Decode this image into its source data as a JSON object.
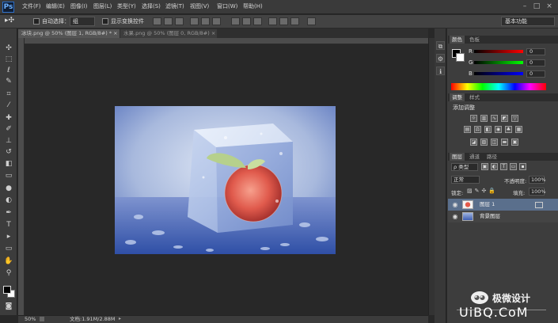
{
  "app": {
    "logo": "Ps"
  },
  "menubar": {
    "items": [
      "文件(F)",
      "编辑(E)",
      "图像(I)",
      "图层(L)",
      "类型(Y)",
      "选择(S)",
      "滤镜(T)",
      "视图(V)",
      "窗口(W)",
      "帮助(H)"
    ],
    "minimize": "–",
    "maximize": "□",
    "close": "×"
  },
  "options": {
    "tool_icon": "move-tool-icon",
    "auto_select_label": "自动选择：",
    "auto_select_value": "组",
    "show_transform_label": "显示变换控件",
    "workspace": "基本功能"
  },
  "tabs": [
    {
      "label": "冰块.png @ 50% (图层 1, RGB/8#) *",
      "close": "×"
    },
    {
      "label": "水果.png @ 50% (图层 0, RGB/8#)",
      "close": "×"
    }
  ],
  "status": {
    "zoom": "50%",
    "doc": "文档:1.91M/2.88M"
  },
  "color_panel": {
    "tabs": [
      "颜色",
      "色板"
    ],
    "channels": [
      {
        "label": "R",
        "value": "0"
      },
      {
        "label": "G",
        "value": "0"
      },
      {
        "label": "B",
        "value": "0"
      }
    ]
  },
  "adjust_panel": {
    "tabs": [
      "调整",
      "样式"
    ],
    "title": "添加调整"
  },
  "layers_panel": {
    "tabs": [
      "图层",
      "通道",
      "路径"
    ],
    "kind": "ρ 类型",
    "blend": "正常",
    "opacity_label": "不透明度:",
    "opacity": "100%",
    "lock_label": "锁定:",
    "fill_label": "填充:",
    "fill": "100%",
    "layers": [
      {
        "name": "图层 1",
        "selected": true
      },
      {
        "name": "背景图层",
        "selected": false
      }
    ]
  },
  "watermark": {
    "brand": "极微设计",
    "site": "UiBQ.CoM"
  },
  "colors": {
    "accent": "#2b6ec9",
    "selected_layer": "#5a6f8c",
    "canvas_blue": "#a5b6d9"
  }
}
